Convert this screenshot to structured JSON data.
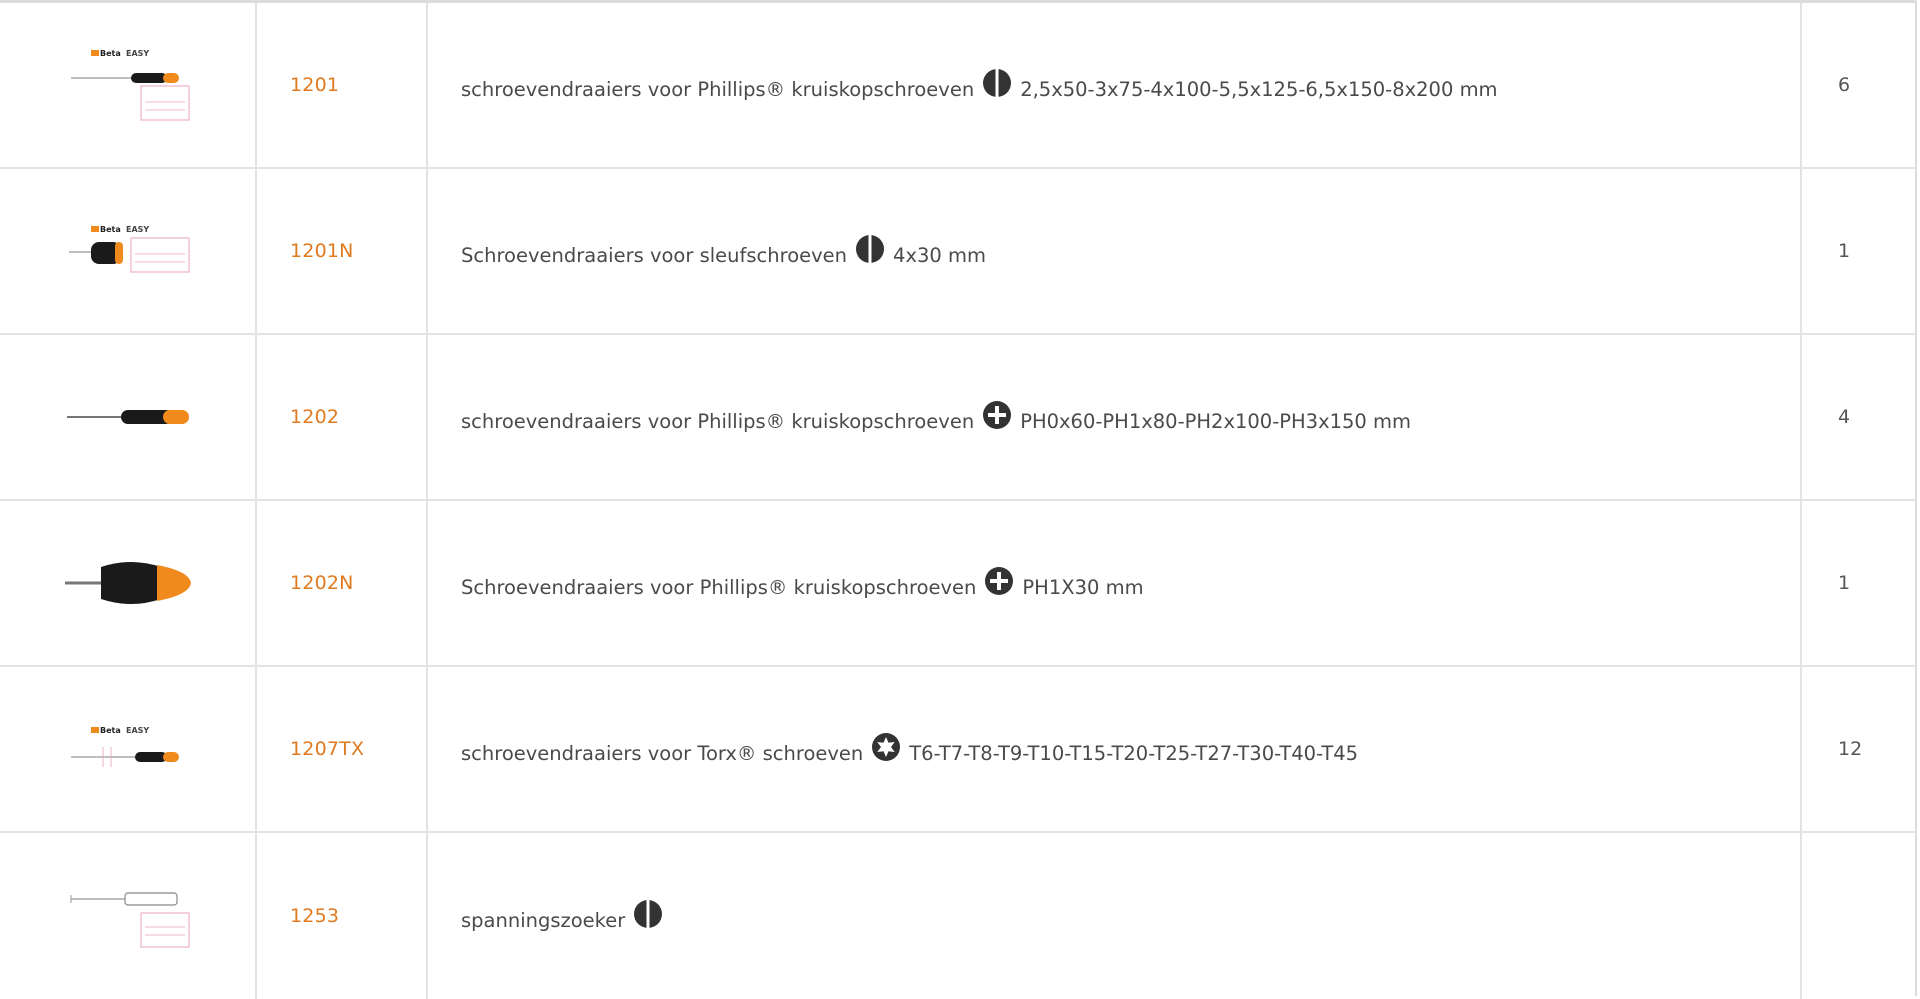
{
  "rows": [
    {
      "code": "1201",
      "desc_text": "schroevendraaiers voor Phillips® kruiskopschroeven",
      "icon": "slotted-tip-icon",
      "spec": "2,5x50-3x75-4x100-5,5x125-6,5x150-8x200 mm",
      "qty": "6",
      "thumb": "betaeasy-set-thumbnail"
    },
    {
      "code": "1201N",
      "desc_text": "Schroevendraaiers voor sleufschroeven",
      "icon": "slotted-tip-icon",
      "spec": "4x30 mm",
      "qty": "1",
      "thumb": "betaeasy-stubby-thumbnail"
    },
    {
      "code": "1202",
      "desc_text": "schroevendraaiers voor Phillips® kruiskopschroeven",
      "icon": "phillips-tip-icon",
      "spec": "PH0x60-PH1x80-PH2x100-PH3x150 mm",
      "qty": "4",
      "thumb": "screwdriver-thumbnail"
    },
    {
      "code": "1202N",
      "desc_text": "Schroevendraaiers voor Phillips® kruiskopschroeven",
      "icon": "phillips-tip-icon",
      "spec": "PH1X30 mm",
      "qty": "1",
      "thumb": "stubby-screwdriver-thumbnail"
    },
    {
      "code": "1207TX",
      "desc_text": "schroevendraaiers voor Torx® schroeven",
      "icon": "torx-tip-icon",
      "spec": "T6-T7-T8-T9-T10-T15-T20-T25-T27-T30-T40-T45",
      "qty": "12",
      "thumb": "betaeasy-torx-thumbnail"
    },
    {
      "code": "1253",
      "desc_text": "spanningszoeker",
      "icon": "slotted-tip-icon",
      "spec": "",
      "qty": "",
      "thumb": "voltage-tester-thumbnail"
    }
  ],
  "colors": {
    "code": "#e07a1f",
    "text": "#4a4a4a",
    "border": "#e3e3e3",
    "handle_orange": "#f08a1c",
    "handle_black": "#1a1a1a"
  },
  "brand_label": "BetaEASY"
}
